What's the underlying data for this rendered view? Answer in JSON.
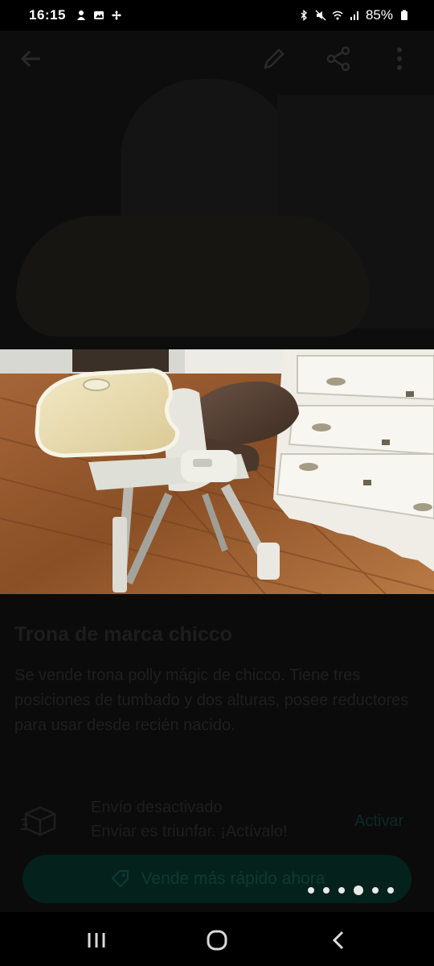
{
  "status_bar": {
    "time": "16:15",
    "battery": "85%",
    "left_icons": [
      "notification-icon",
      "gallery-icon",
      "fan-icon"
    ],
    "right_icons": [
      "bluetooth-icon",
      "mute-icon",
      "wifi-icon",
      "signal-icon",
      "battery-icon"
    ]
  },
  "top_bar": {
    "icons": [
      "back-arrow-icon",
      "edit-pencil-icon",
      "share-icon",
      "more-options-icon"
    ]
  },
  "listing": {
    "title": "Trona de marca chicco",
    "description": "Se vende trona polly mágic de chicco. Tiene tres posiciones de tumbado y dos alturas, posee reductores para usar desde recién nacido.",
    "shipping_title": "Envío desactivado",
    "shipping_subtitle": "Enviar es triunfar. ¡Actívalo!",
    "shipping_action": "Activar",
    "sell_faster_button": "Vende más rápido ahora"
  },
  "carousel": {
    "dot_count": 6,
    "active_index": 3
  },
  "colors": {
    "accent_dimmed": "#05211c",
    "background": "#0b0b0b"
  },
  "nav_bar": {
    "icons": [
      "recents-icon",
      "home-icon",
      "back-icon"
    ]
  }
}
